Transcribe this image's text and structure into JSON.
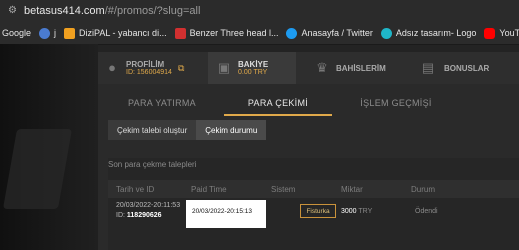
{
  "browser": {
    "url_host": "betasus414.com",
    "url_path": "/#/promos/?slug=all"
  },
  "bookmarks": [
    {
      "label": "Google",
      "color": "#ffffff"
    },
    {
      "label": "j",
      "color": "#4a7bd0"
    },
    {
      "label": "DiziPAL - yabancı di...",
      "color": "#f0a020"
    },
    {
      "label": "Benzer Three head l...",
      "color": "#d23030"
    },
    {
      "label": "Anasayfa / Twitter",
      "color": "#1d9bf0"
    },
    {
      "label": "Adsız tasarım- Logo",
      "color": "#1fb6c8"
    },
    {
      "label": "YouTube",
      "color": "#ff0000"
    }
  ],
  "nav": {
    "profile_label": "PROFİLİM",
    "profile_id": "ID: 156004914",
    "balance_label": "BAKİYE",
    "balance_value": "0.00 TRY",
    "bets_label": "BAHİSLERİM",
    "bonus_label": "BONUSLAR"
  },
  "tabs": [
    "PARA YATIRMA",
    "PARA ÇEKİMİ",
    "İŞLEM GEÇMİŞİ"
  ],
  "subtabs": [
    "Çekim talebi oluştur",
    "Çekim durumu"
  ],
  "section_title": "Son para çekme talepleri",
  "table": {
    "headers": [
      "Tarih ve ID",
      "Paid Time",
      "Sistem",
      "Miktar",
      "Durum"
    ],
    "row": {
      "date": "20/03/2022-20:11:53",
      "id_prefix": "ID:",
      "id": "118290626",
      "paid_time": "20/03/2022-20:15:13",
      "system": "Fisturka",
      "amount": "3000",
      "currency": "TRY",
      "status": "Ödendi"
    }
  }
}
